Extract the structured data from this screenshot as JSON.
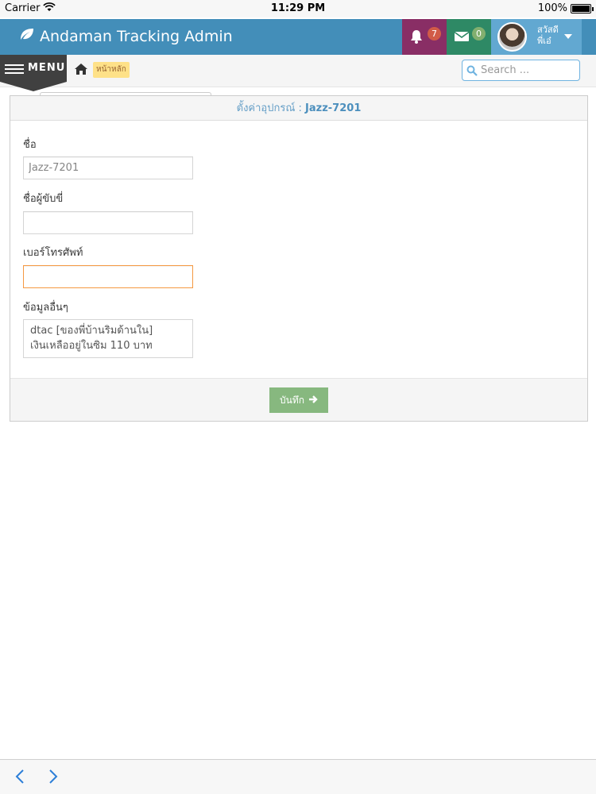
{
  "status_bar": {
    "carrier": "Carrier",
    "time": "11:29 PM",
    "battery_percent": "100%",
    "battery_level": 1.0
  },
  "header": {
    "brand_icon": "leaf-icon",
    "brand_title": "Andaman Tracking Admin",
    "notifications": {
      "icon": "bell-icon",
      "count": "7"
    },
    "messages": {
      "icon": "envelope-icon",
      "count": "0"
    },
    "user": {
      "greeting": "สวัสดี",
      "name": "พี่เอ๋",
      "dropdown_icon": "caret-down-icon"
    },
    "colors": {
      "bar": "#438eb9",
      "notifications": "#892e65",
      "messages": "#2e8965",
      "user": "#62a8d1"
    }
  },
  "breadcrumb": {
    "menu_label": "MENU",
    "home_icon": "home-icon",
    "active": "หน้าหลัก"
  },
  "search": {
    "icon": "search-icon",
    "placeholder": "Search ..."
  },
  "form": {
    "title_prefix": "ตั้งค่าอุปกรณ์ :",
    "device_name": "Jazz-7201",
    "fields": {
      "name": {
        "label": "ชื่อ",
        "value": "Jazz-7201"
      },
      "driver": {
        "label": "ชื่อผู้ขับขี่",
        "value": ""
      },
      "phone": {
        "label": "เบอร์โทรศัพท์",
        "value": ""
      },
      "other": {
        "label": "ข้อมูลอื่นๆ",
        "value": "dtac [ของพี่บ้านริมด้านใน]\nเงินเหลืออยู่ในซิม 110 บาท"
      }
    },
    "save_label": "บันทึก",
    "save_icon": "arrow-right-icon"
  },
  "toolbar": {
    "back_icon": "chevron-left-icon",
    "forward_icon": "chevron-right-icon"
  }
}
